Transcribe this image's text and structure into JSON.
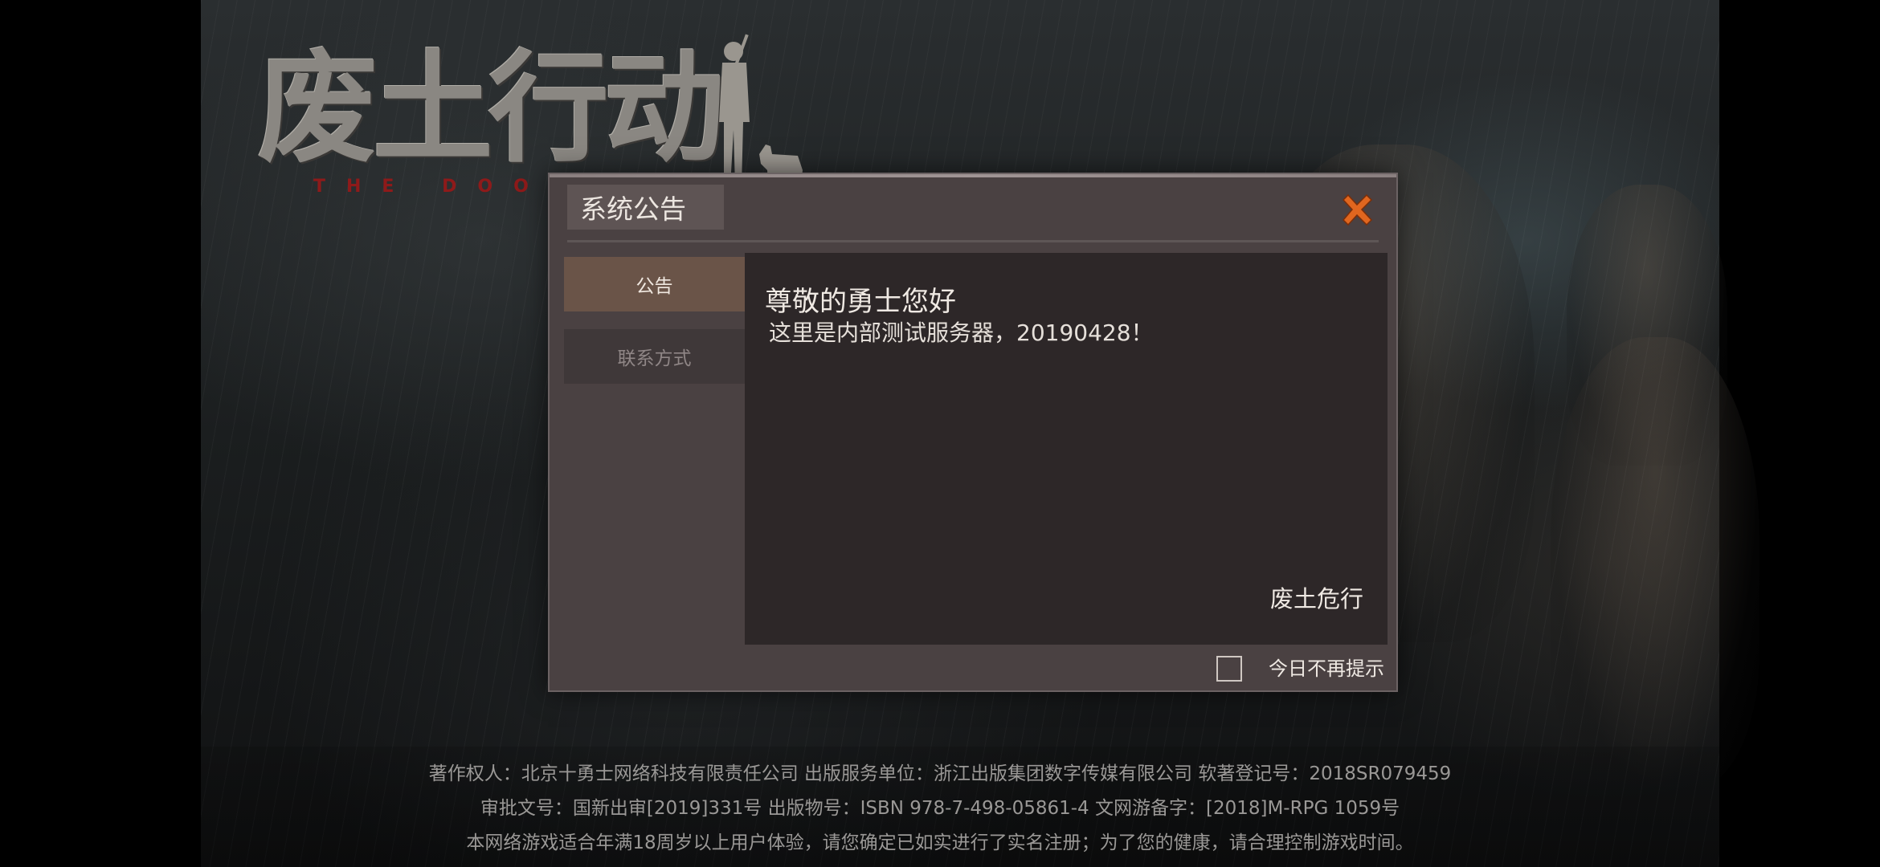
{
  "game_logo": {
    "title": "废土行动",
    "subtitle": "THE DOOMS"
  },
  "dialog": {
    "title": "系统公告",
    "close_icon": "close-x-icon",
    "tabs": [
      {
        "label": "公告",
        "active": true
      },
      {
        "label": "联系方式",
        "active": false
      }
    ],
    "content": {
      "greeting": "尊敬的勇士您好",
      "message": "这里是内部测试服务器，20190428！",
      "signature": "废土危行"
    },
    "checkbox": {
      "label": "今日不再提示",
      "checked": false
    }
  },
  "footer": {
    "lines": [
      "著作权人：北京十勇士网络科技有限责任公司    出版服务单位：浙江出版集团数字传媒有限公司    软著登记号：2018SR079459",
      "审批文号：国新出审[2019]331号    出版物号：ISBN 978-7-498-05861-4    文网游备字：[2018]M-RPG 1059号",
      "本网络游戏适合年满18周岁以上用户体验，请您确定已如实进行了实名注册；为了您的健康，请合理控制游戏时间。"
    ]
  },
  "colors": {
    "accent_orange": "#e0661f",
    "dialog_bg": "#4a4142",
    "content_bg": "#2d2728",
    "active_tab": "#6a5448",
    "logo_red": "#8e1a1a"
  }
}
